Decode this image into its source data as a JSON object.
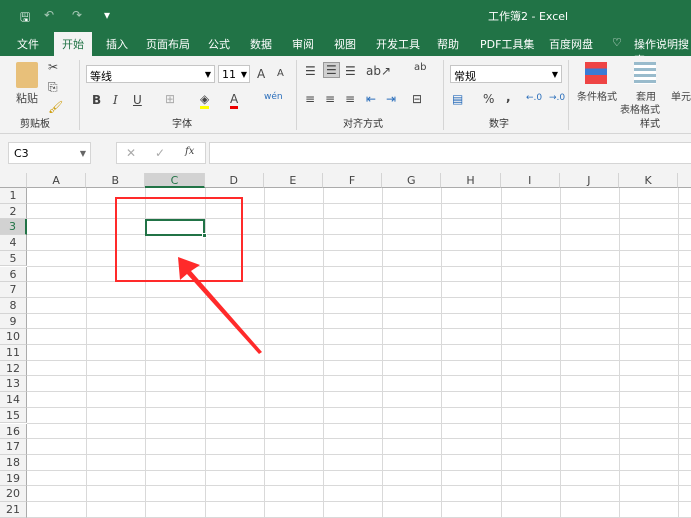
{
  "title": "工作簿2  -  Excel",
  "quick_access": {
    "save": "save-icon",
    "undo": "↶",
    "redo": "↷",
    "more": "▾"
  },
  "tabs": [
    "文件",
    "开始",
    "插入",
    "页面布局",
    "公式",
    "数据",
    "审阅",
    "视图",
    "开发工具",
    "帮助",
    "PDF工具集",
    "百度网盘",
    "操作说明搜索"
  ],
  "active_tab": "开始",
  "ribbon": {
    "clipboard": {
      "paste": "粘贴",
      "label": "剪贴板"
    },
    "font": {
      "name": "等线",
      "size": "11",
      "label": "字体",
      "bold": "B",
      "italic": "I",
      "underline": "U",
      "grow": "A",
      "shrink": "A",
      "color": "A",
      "phonetic": "wén"
    },
    "alignment": {
      "label": "对齐方式"
    },
    "number": {
      "format": "常规",
      "label": "数字",
      "percent": "%",
      "comma": ","
    },
    "styles": {
      "conditional": "条件格式",
      "table_1": "套用",
      "table_2": "表格格式",
      "cell": "单元",
      "label": "样式"
    }
  },
  "formula_bar": {
    "name_box": "C3",
    "cancel": "✕",
    "enter": "✓",
    "fx": "fx",
    "value": ""
  },
  "columns": [
    "A",
    "B",
    "C",
    "D",
    "E",
    "F",
    "G",
    "H",
    "I",
    "J",
    "K"
  ],
  "rows": [
    "1",
    "2",
    "3",
    "4",
    "5",
    "6",
    "7",
    "8",
    "9",
    "10",
    "11",
    "12",
    "13",
    "14",
    "15",
    "16",
    "17",
    "18",
    "19",
    "20",
    "21"
  ],
  "selected_cell": "C3",
  "colors": {
    "accent": "#217346",
    "annotation": "#ff2a2a"
  }
}
